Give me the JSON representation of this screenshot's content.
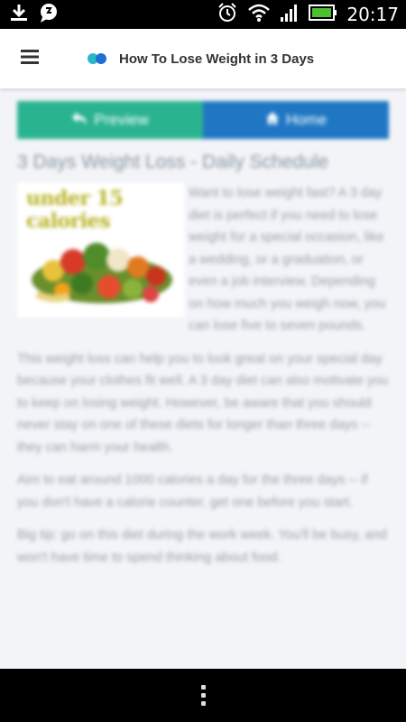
{
  "status_bar": {
    "time": "20:17",
    "icons": [
      "download-icon",
      "chat-icon",
      "alarm-icon",
      "wifi-icon",
      "signal-icon",
      "battery-icon"
    ]
  },
  "app_bar": {
    "title": "How To Lose Weight in 3 Days",
    "icons": [
      "menu-icon",
      "app-logo"
    ]
  },
  "toolbar": {
    "preview_label": "Preview",
    "home_label": "Home",
    "preview_color": "#2ab38f",
    "home_color": "#1f77c3"
  },
  "article": {
    "title": "3 Days Weight Loss - Daily Schedule",
    "image_caption": "under 15 calories",
    "paragraphs": [
      "Want to lose weight fast? A 3 day diet is perfect if you need to lose weight for a special occasion, like a wedding, or a graduation, or even a job interview. Depending on how much you weigh now, you can lose five to seven pounds.",
      "This weight loss can help you to look great on your special day because your clothes fit well. A 3 day diet can also motivate you to keep on losing weight. However, be aware that you should never stay on one of these diets for longer than three days -- they can harm your health.",
      "Aim to eat around 1000 calories a day for the three days -- if you don't have a calorie counter, get one before you start.",
      "Big tip: go on this diet during the work week. You'll be busy, and won't have time to spend thinking about food."
    ]
  },
  "bottom_bar": {
    "icons": [
      "overflow-menu-icon"
    ]
  }
}
